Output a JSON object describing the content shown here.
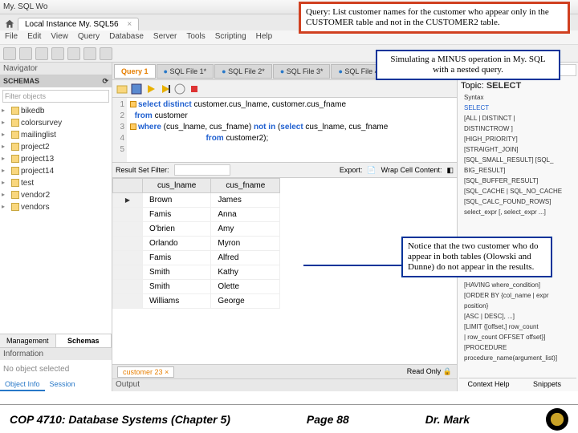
{
  "window": {
    "title": "My. SQL Wo"
  },
  "conn_tab": {
    "label": "Local Instance My. SQL56",
    "close": "×"
  },
  "menu": [
    "File",
    "Edit",
    "View",
    "Query",
    "Database",
    "Server",
    "Tools",
    "Scripting",
    "Help"
  ],
  "navigator": {
    "title": "Navigator",
    "schemas_label": "SCHEMAS",
    "filter_placeholder": "Filter objects",
    "schemas": [
      "bikedb",
      "colorsurvey",
      "mailinglist",
      "project2",
      "project13",
      "project14",
      "test",
      "vendor2",
      "vendors"
    ],
    "tabs": {
      "management": "Management",
      "schemas": "Schemas"
    },
    "info_title": "Information",
    "info_text": "No object selected",
    "info_tabs": {
      "obj": "Object Info",
      "session": "Session"
    }
  },
  "query_tabs": [
    {
      "label": "Query 1",
      "active": true
    },
    {
      "label": "SQL File 1*"
    },
    {
      "label": "SQL File 2*"
    },
    {
      "label": "SQL File 3*"
    },
    {
      "label": "SQL File 4*"
    }
  ],
  "code": {
    "lines": [
      "1",
      "2",
      "3",
      "4",
      "5"
    ],
    "l1a": "select distinct",
    "l1b": " customer.cus_lname, customer.cus_fname",
    "l2a": "from",
    "l2b": " customer",
    "l3a": "where",
    "l3b": " (cus_lname, cus_fname) ",
    "l3c": "not in",
    "l3d": " (",
    "l3e": "select",
    "l3f": " cus_lname, cus_fname",
    "l4a": "from",
    "l4b": " customer2);"
  },
  "result_bar": {
    "label": "Result Set Filter:",
    "export": "Export:",
    "wrap": "Wrap Cell Content:"
  },
  "grid": {
    "headers": [
      "cus_lname",
      "cus_fname"
    ],
    "rows": [
      [
        "Brown",
        "James"
      ],
      [
        "Famis",
        "Anna"
      ],
      [
        "O'brien",
        "Amy"
      ],
      [
        "Orlando",
        "Myron"
      ],
      [
        "Famis",
        "Alfred"
      ],
      [
        "Smith",
        "Kathy"
      ],
      [
        "Smith",
        "Olette"
      ],
      [
        "Williams",
        "George"
      ]
    ],
    "footer_left": "customer 23",
    "footer_right": "Read Only"
  },
  "output_label": "Output",
  "right": {
    "select_label": "SELECT",
    "nav_prev": "←",
    "nav_next": "→",
    "topic_label": "Topic:",
    "topic_value": "SELECT",
    "syntax_label": "Syntax",
    "syntax_kw": "SELECT",
    "opts": [
      "[ALL | DISTINCT |",
      "DISTINCTROW ]",
      "[HIGH_PRIORITY]",
      "[STRAIGHT_JOIN]",
      "[SQL_SMALL_RESULT] [SQL_",
      "BIG_RESULT] [SQL_BUFFER_RESULT]",
      "[SQL_CACHE | SQL_NO_CACHE",
      "[SQL_CALC_FOUND_ROWS]",
      "select_expr [, select_expr ...]"
    ],
    "tail": [
      "[HAVING where_condition]",
      "[ORDER BY {col_name | expr",
      "position}",
      "[ASC | DESC], ...]",
      "[LIMIT {[offset,] row_count",
      "| row_count OFFSET offset}]",
      "[PROCEDURE",
      "procedure_name(argument_list)]"
    ],
    "tabs": {
      "help": "Context Help",
      "snip": "Snippets"
    }
  },
  "callouts": {
    "c1": "Query: List customer names for the customer who appear only in the CUSTOMER table and not in the CUSTOMER2 table.",
    "c2": "Simulating a MINUS operation in My. SQL with a nested query.",
    "c3": "Notice that the two customer who do appear in both tables (Olowski and Dunne) do not appear in the results."
  },
  "footer": {
    "left": "COP 4710: Database Systems  (Chapter 5)",
    "center": "Page 88",
    "right": "Dr. Mark"
  }
}
